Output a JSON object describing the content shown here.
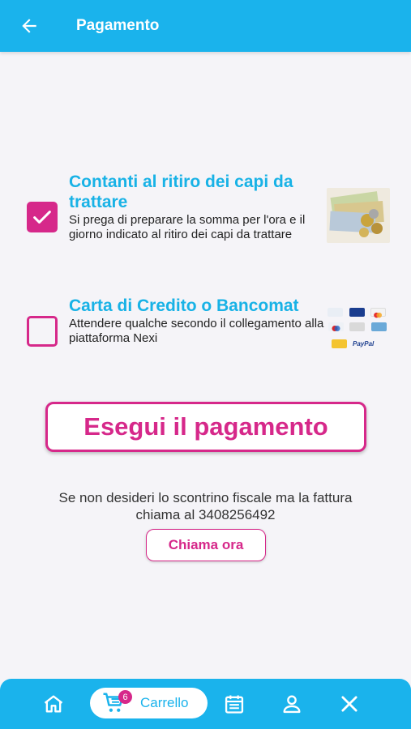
{
  "appbar": {
    "title": "Pagamento"
  },
  "payment_options": [
    {
      "title": "Contanti al ritiro dei capi da trattare",
      "description": "Si prega di preparare la somma per l'ora e il giorno indicato al ritiro dei capi da trattare",
      "checked": true
    },
    {
      "title": "Carta di Credito o Bancomat",
      "description": "Attendere qualche secondo il collegamento alla piattaforma Nexi",
      "checked": false
    }
  ],
  "pay_button_label": "Esegui il pagamento",
  "invoice_info": {
    "line1": "Se non desideri lo scontrino fiscale ma la fattura",
    "line2": "chiama al 3408256492"
  },
  "call_button_label": "Chiama ora",
  "bottom_nav": {
    "cart_label": "Carrello",
    "cart_count": "6"
  },
  "colors": {
    "primary": "#1ab3ec",
    "accent": "#d6288a",
    "background": "#f5f4f8"
  }
}
